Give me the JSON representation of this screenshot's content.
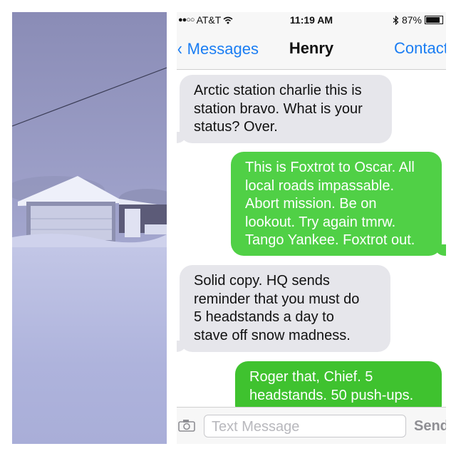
{
  "status_bar": {
    "signal": "●●○○",
    "carrier": "AT&T",
    "wifi_icon": "wifi-icon",
    "time": "11:19 AM",
    "bluetooth_icon": "bluetooth-icon",
    "battery_percent": "87%",
    "battery_level": 0.87
  },
  "nav": {
    "back_label": "Messages",
    "title": "Henry",
    "contact_label": "Contact"
  },
  "messages": [
    {
      "direction": "incoming",
      "lines": [
        "Arctic station charlie this is",
        "station bravo. What is your",
        "status? Over."
      ]
    },
    {
      "direction": "outgoing",
      "lines": [
        "This is Foxtrot to Oscar. All",
        "local roads impassable.",
        "Abort mission. Be on",
        "lookout. Try again tmrw.",
        "Tango Yankee. Foxtrot out."
      ]
    },
    {
      "direction": "incoming",
      "lines": [
        "Solid copy. HQ sends",
        "reminder that you must do",
        "5 headstands a day to",
        "stave off snow madness."
      ]
    },
    {
      "direction": "outgoing",
      "lines": [
        "Roger that, Chief. 5",
        "headstands. 50 push-ups."
      ]
    }
  ],
  "input": {
    "placeholder": "Text Message",
    "send_label": "Send",
    "camera_icon": "camera-icon"
  },
  "colors": {
    "ios_blue": "#1a7df3",
    "incoming_bubble": "#e6e6eb",
    "outgoing_bubble": "#50d046"
  }
}
